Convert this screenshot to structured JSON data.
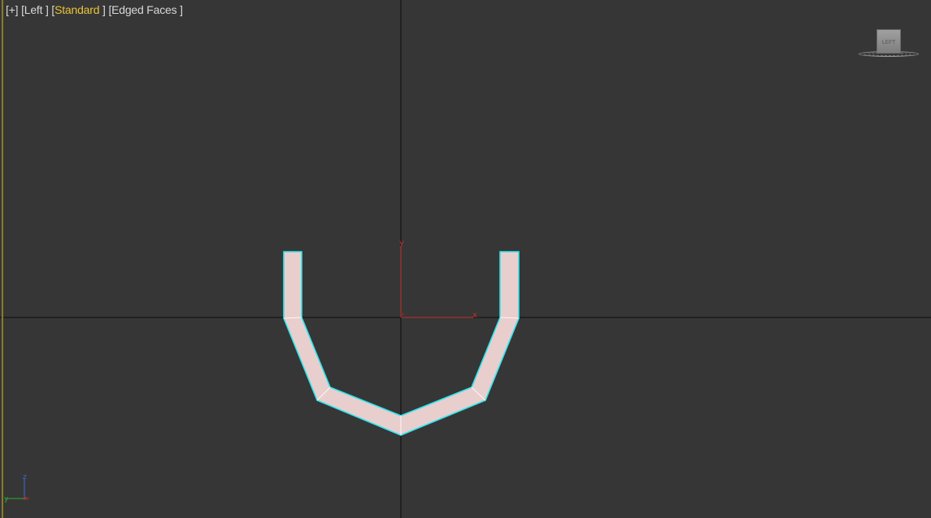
{
  "viewport": {
    "label": {
      "plus": "[+]",
      "view": "[Left ]",
      "shading_open": "[",
      "shading": "Standard",
      "shading_close": "]",
      "display": "[Edged Faces ]"
    },
    "viewcube": {
      "face_label": "LEFT"
    },
    "gizmo": {
      "y": "y",
      "z": "z",
      "x": "x"
    },
    "corner_axes": {
      "z": "z",
      "y": "y",
      "x": "x"
    }
  },
  "colors": {
    "background": "#363636",
    "mesh_fill": "#e8cccc",
    "selection_edge": "#2ee6ee",
    "shading_label": "#e8c43a",
    "grid_axis": "#000000",
    "gizmo": "#c0302c"
  }
}
